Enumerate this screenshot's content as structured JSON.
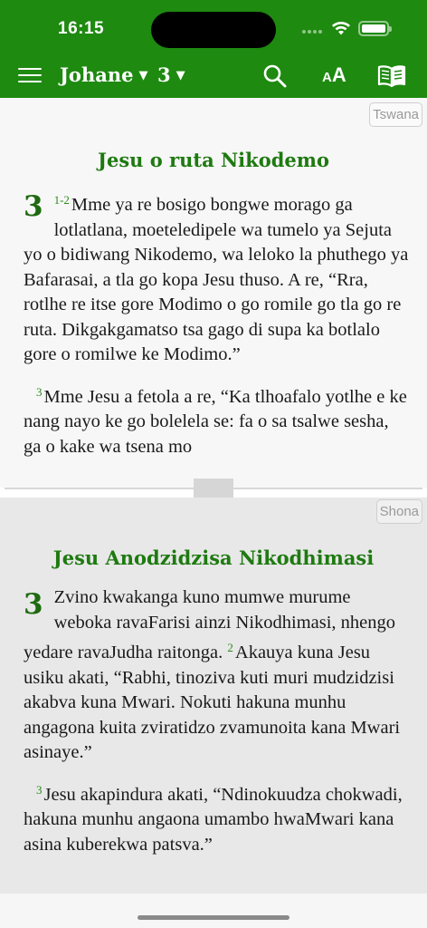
{
  "status_bar": {
    "time": "16:15"
  },
  "toolbar": {
    "book": "Johane",
    "chapter": "3",
    "caret": "▼",
    "font_small": "A",
    "font_big": "A",
    "accent_color": "#1e8a10"
  },
  "top_pane": {
    "language": "Tswana",
    "section_title": "Jesu o ruta Nikodemo",
    "chapter_number": "3",
    "paragraphs": [
      {
        "verse": "1-2",
        "text": "Mme ya re bosigo bongwe morago ga lotlatlana, moeteledipele wa tumelo ya Sejuta yo o bidiwang Nikodemo, wa leloko la phuthego ya Bafarasai, a tla go kopa Jesu thuso. A re, “Rra, rotlhe re itse gore Modimo o go romile go tla go re ruta. Dikgakgamatso tsa gago di supa ka botlalo gore o romilwe ke Modimo.”"
      },
      {
        "verse": "3",
        "text": "Mme Jesu a fetola a re, “Ka tlhoafalo yotlhe e ke nang nayo ke go bolelela se: fa o sa tsalwe sesha, ga o kake wa tsena mo"
      }
    ]
  },
  "bottom_pane": {
    "language": "Shona",
    "section_title": "Jesu Anodzidzisa Nikodhimasi",
    "chapter_number": "3",
    "p1_text": "Zvino kwakanga kuno mumwe murume weboka ravaFarisi ainzi Nikodhimasi, nhengo yedare ravaJudha raitonga.",
    "p1_verse2": "2",
    "p1_text2": "Akauya kuna Jesu usiku akati, “Rabhi, tinoziva kuti muri mudzidzisi akabva kuna Mwari. Nokuti hakuna munhu angagona kuita zviratidzo zvamunoita kana Mwari asinaye.”",
    "p2_verse": "3",
    "p2_text": "Jesu akapindura akati, “Ndinokuudza chokwadi, hakuna munhu angaona umambo hwaMwari kana asina kuberekwa patsva.”"
  }
}
